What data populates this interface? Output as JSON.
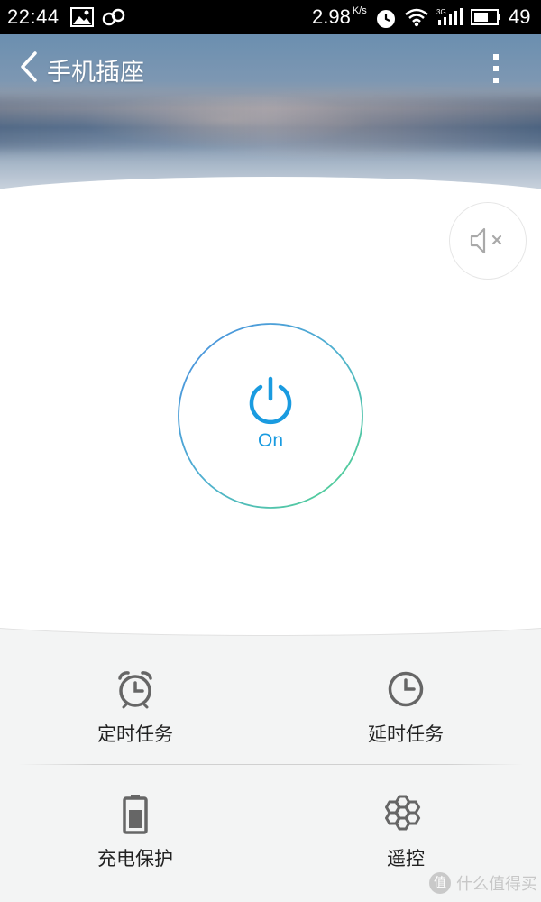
{
  "status_bar": {
    "time": "22:44",
    "speed_value": "2.98",
    "speed_unit": "K/s",
    "network_type": "3G",
    "battery": "49",
    "icons": [
      "image-icon",
      "link-icon",
      "alarm-icon",
      "wifi-icon",
      "signal-icon",
      "battery-icon"
    ]
  },
  "header": {
    "title": "手机插座",
    "back_icon": "chevron-left-icon",
    "menu_icon": "more-vertical-icon"
  },
  "mute": {
    "icon": "speaker-muted-icon"
  },
  "power": {
    "state": "On",
    "icon": "power-icon",
    "color": "#1a9be0"
  },
  "functions": [
    {
      "label": "定时任务",
      "icon": "alarm-clock-icon"
    },
    {
      "label": "延时任务",
      "icon": "clock-icon"
    },
    {
      "label": "充电保护",
      "icon": "battery-icon"
    },
    {
      "label": "遥控",
      "icon": "hexagon-cluster-icon"
    }
  ],
  "watermark": {
    "badge": "值",
    "text": "什么值得买"
  },
  "colors": {
    "accent": "#1a9be0",
    "panel_bg": "#f3f4f4",
    "icon_gray": "#666666"
  }
}
